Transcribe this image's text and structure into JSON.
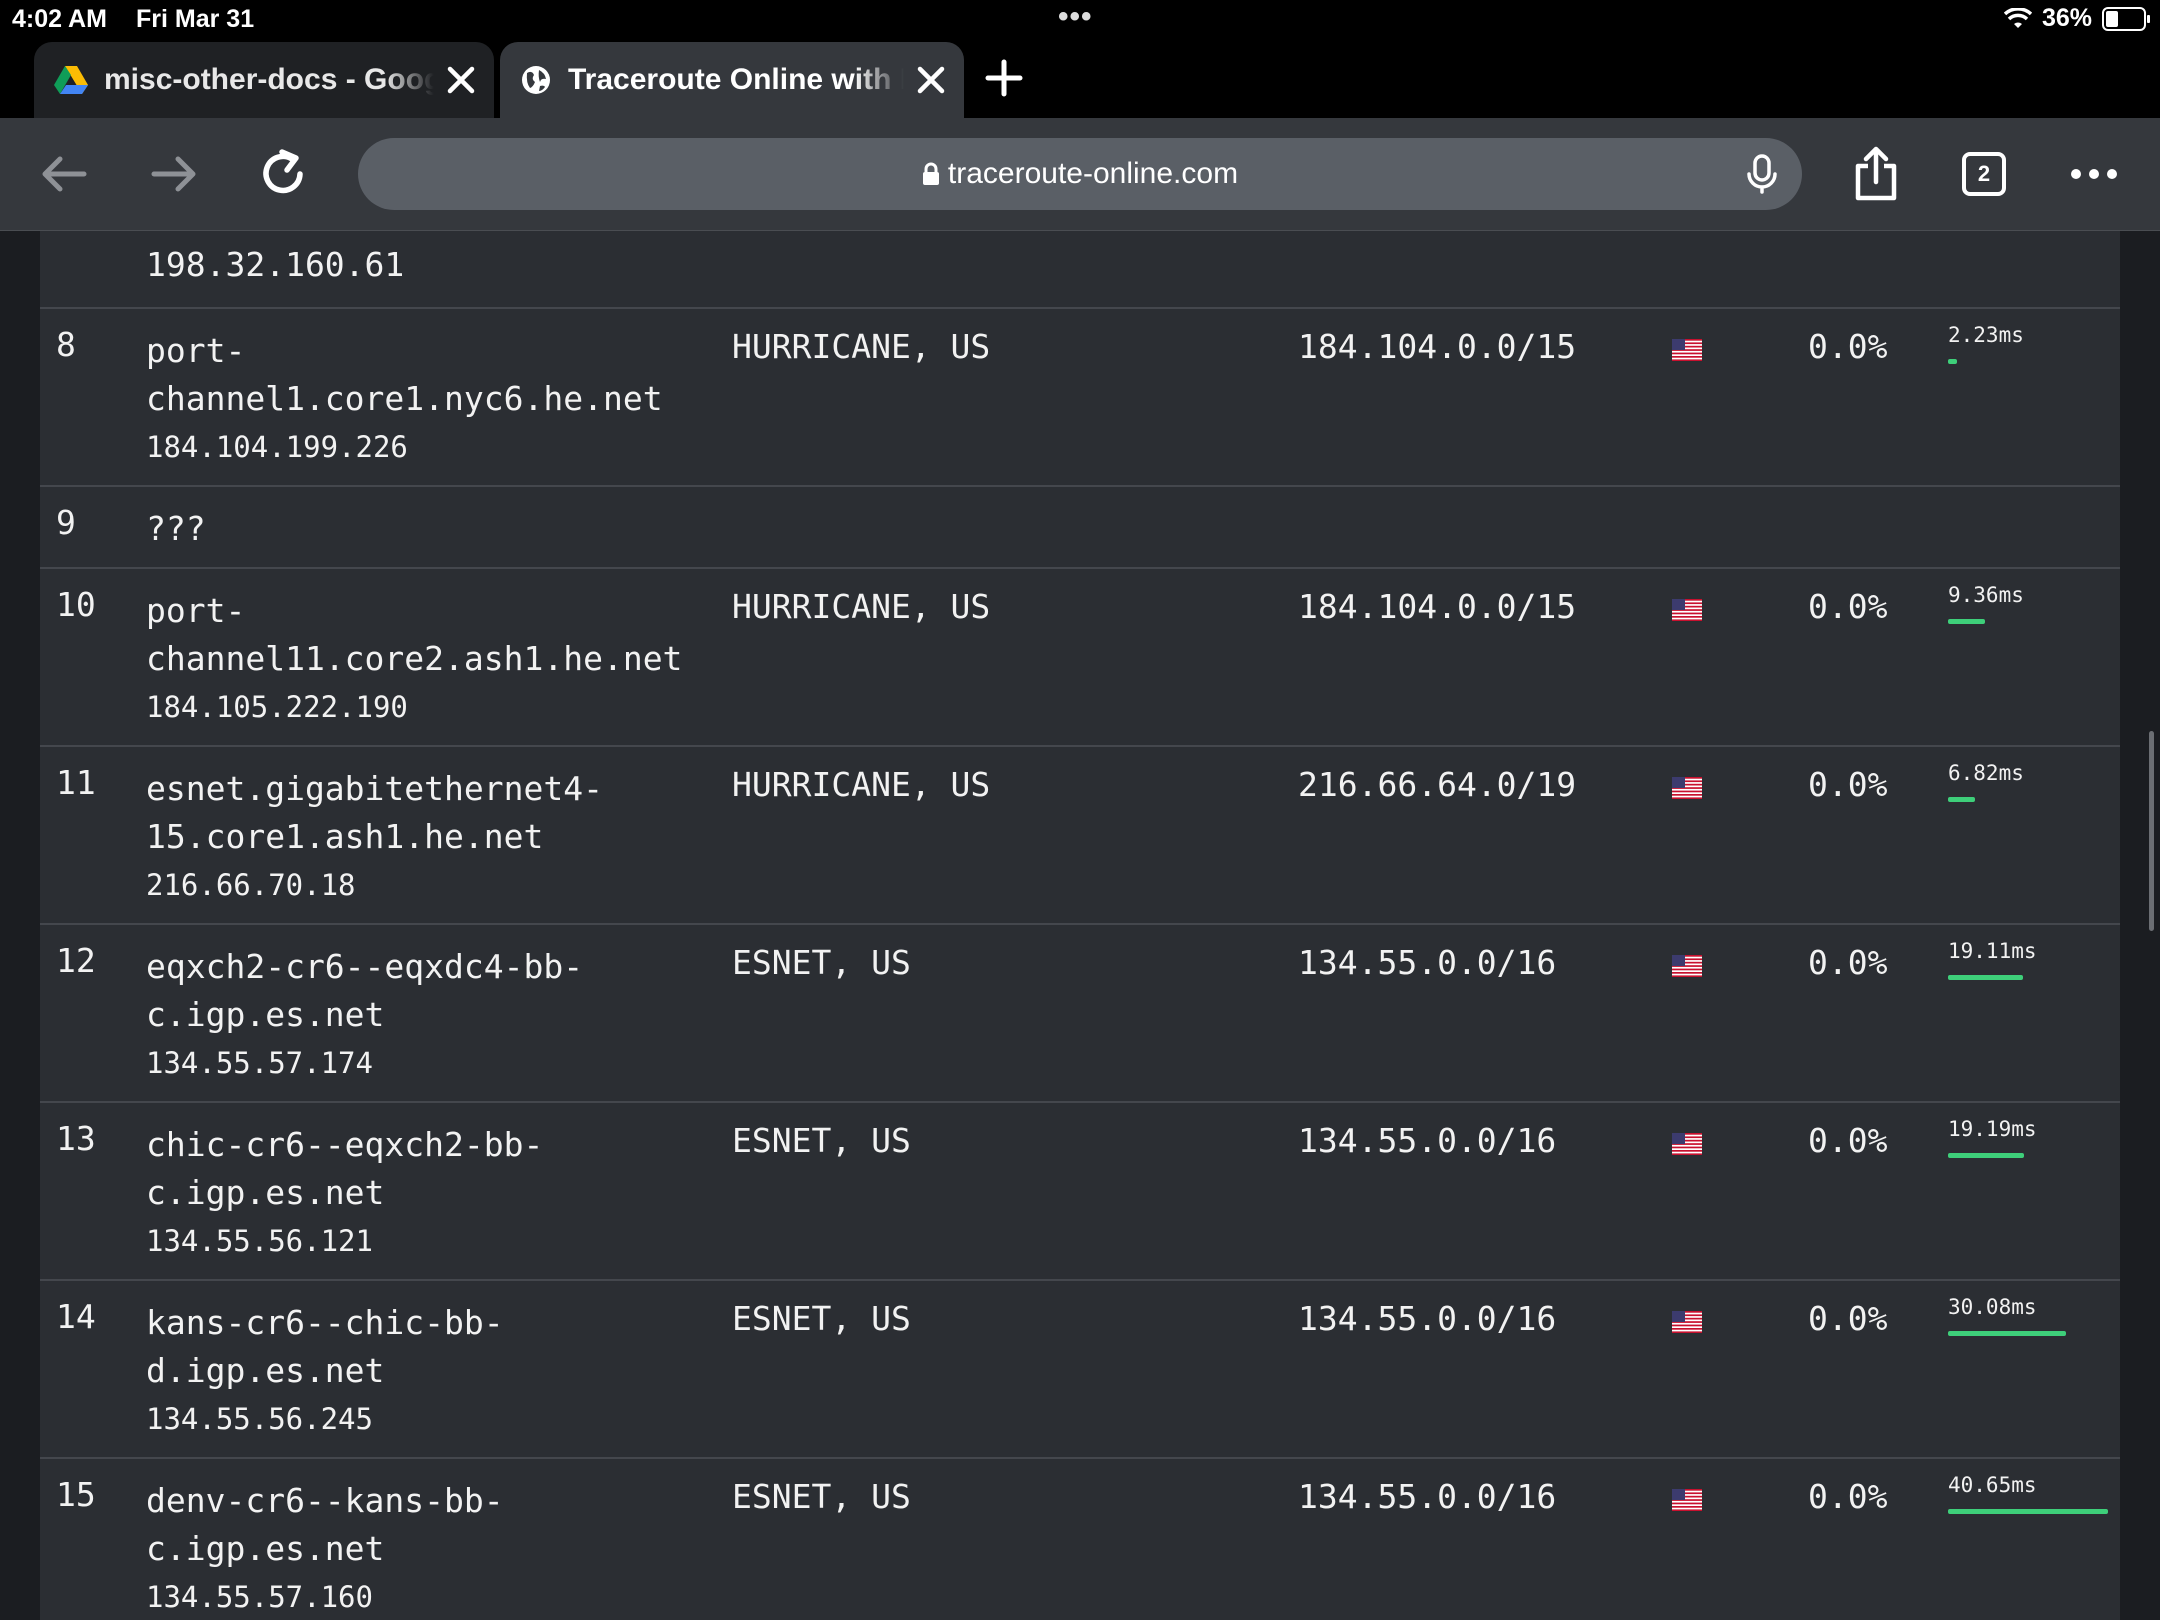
{
  "status": {
    "time": "4:02 AM",
    "date": "Fri Mar 31",
    "battery": "36%"
  },
  "tabs": [
    {
      "title": "misc-other-docs - Google Drive",
      "icon": "google-drive-icon"
    },
    {
      "title": "Traceroute Online with Map",
      "icon": "globe-icon",
      "active": true
    }
  ],
  "toolbar": {
    "url": "traceroute-online.com",
    "tab_count": "2"
  },
  "traceroute": {
    "top_partial_ip": "198.32.160.61",
    "hops": [
      {
        "hop": "8",
        "host_line1": "port-",
        "host_line2": "channel1.core1.nyc6.he.net",
        "ip": "184.104.199.226",
        "asn": "HURRICANE, US",
        "network": "184.104.0.0/15",
        "loss": "0.0%",
        "time": "2.23ms",
        "time_ms": 2.23
      },
      {
        "hop": "9",
        "host_line1": "???"
      },
      {
        "hop": "10",
        "host_line1": "port-",
        "host_line2": "channel11.core2.ash1.he.net",
        "ip": "184.105.222.190",
        "asn": "HURRICANE, US",
        "network": "184.104.0.0/15",
        "loss": "0.0%",
        "time": "9.36ms",
        "time_ms": 9.36
      },
      {
        "hop": "11",
        "host_line1": "esnet.gigabitethernet4-",
        "host_line2": "15.core1.ash1.he.net",
        "ip": "216.66.70.18",
        "asn": "HURRICANE, US",
        "network": "216.66.64.0/19",
        "loss": "0.0%",
        "time": "6.82ms",
        "time_ms": 6.82
      },
      {
        "hop": "12",
        "host_line1": "eqxch2-cr6--eqxdc4-bb-",
        "host_line2": "c.igp.es.net",
        "ip": "134.55.57.174",
        "asn": "ESNET, US",
        "network": "134.55.0.0/16",
        "loss": "0.0%",
        "time": "19.11ms",
        "time_ms": 19.11
      },
      {
        "hop": "13",
        "host_line1": "chic-cr6--eqxch2-bb-",
        "host_line2": "c.igp.es.net",
        "ip": "134.55.56.121",
        "asn": "ESNET, US",
        "network": "134.55.0.0/16",
        "loss": "0.0%",
        "time": "19.19ms",
        "time_ms": 19.19
      },
      {
        "hop": "14",
        "host_line1": "kans-cr6--chic-bb-",
        "host_line2": "d.igp.es.net",
        "ip": "134.55.56.245",
        "asn": "ESNET, US",
        "network": "134.55.0.0/16",
        "loss": "0.0%",
        "time": "30.08ms",
        "time_ms": 30.08
      },
      {
        "hop": "15",
        "host_line1": "denv-cr6--kans-bb-",
        "host_line2": "c.igp.es.net",
        "ip": "134.55.57.160",
        "asn": "ESNET, US",
        "network": "134.55.0.0/16",
        "loss": "0.0%",
        "time": "40.65ms",
        "time_ms": 40.65
      }
    ]
  },
  "colors": {
    "latency_bar": "#3ecf7a",
    "row_bg": "#2b2e33",
    "page_bg": "#1b1d21"
  }
}
